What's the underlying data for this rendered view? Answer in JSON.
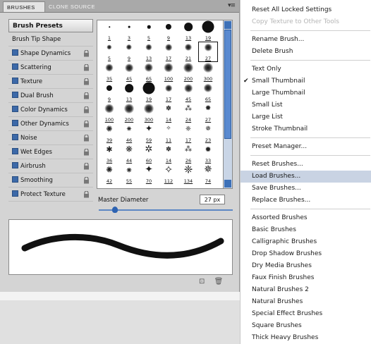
{
  "panel": {
    "tabs": [
      "BRUSHES",
      "CLONE SOURCE"
    ],
    "menu_icon": "panel-menu-icon"
  },
  "sidebar": {
    "header": "Brush Presets",
    "items": [
      {
        "label": "Brush Tip Shape",
        "checkbox": false,
        "lock": false
      },
      {
        "label": "Shape Dynamics",
        "checkbox": true,
        "lock": true
      },
      {
        "label": "Scattering",
        "checkbox": true,
        "lock": true
      },
      {
        "label": "Texture",
        "checkbox": true,
        "lock": true
      },
      {
        "label": "Dual Brush",
        "checkbox": true,
        "lock": true
      },
      {
        "label": "Color Dynamics",
        "checkbox": true,
        "lock": true
      },
      {
        "label": "Other Dynamics",
        "checkbox": true,
        "lock": true
      },
      {
        "label": "Noise",
        "checkbox": true,
        "lock": true
      },
      {
        "label": "Wet Edges",
        "checkbox": true,
        "lock": true
      },
      {
        "label": "Airbrush",
        "checkbox": true,
        "lock": true
      },
      {
        "label": "Smoothing",
        "checkbox": true,
        "lock": true
      },
      {
        "label": "Protect Texture",
        "checkbox": true,
        "lock": true
      }
    ]
  },
  "brushes": [
    {
      "size": "1",
      "kind": "hard"
    },
    {
      "size": "3",
      "kind": "hard"
    },
    {
      "size": "5",
      "kind": "hard"
    },
    {
      "size": "9",
      "kind": "hard"
    },
    {
      "size": "13",
      "kind": "hard"
    },
    {
      "size": "19",
      "kind": "hard"
    },
    {
      "size": "5",
      "kind": "soft"
    },
    {
      "size": "9",
      "kind": "soft"
    },
    {
      "size": "13",
      "kind": "soft"
    },
    {
      "size": "17",
      "kind": "soft"
    },
    {
      "size": "21",
      "kind": "soft"
    },
    {
      "size": "27",
      "kind": "soft"
    },
    {
      "size": "35",
      "kind": "soft"
    },
    {
      "size": "45",
      "kind": "soft"
    },
    {
      "size": "65",
      "kind": "soft"
    },
    {
      "size": "100",
      "kind": "soft"
    },
    {
      "size": "200",
      "kind": "soft"
    },
    {
      "size": "300",
      "kind": "soft"
    },
    {
      "size": "9",
      "kind": "hard"
    },
    {
      "size": "13",
      "kind": "hard"
    },
    {
      "size": "19",
      "kind": "hard"
    },
    {
      "size": "17",
      "kind": "soft"
    },
    {
      "size": "45",
      "kind": "soft"
    },
    {
      "size": "65",
      "kind": "soft"
    },
    {
      "size": "100",
      "kind": "soft"
    },
    {
      "size": "200",
      "kind": "soft"
    },
    {
      "size": "300",
      "kind": "soft"
    },
    {
      "size": "14",
      "kind": "special"
    },
    {
      "size": "24",
      "kind": "special"
    },
    {
      "size": "27",
      "kind": "special"
    },
    {
      "size": "39",
      "kind": "special"
    },
    {
      "size": "46",
      "kind": "special"
    },
    {
      "size": "59",
      "kind": "special"
    },
    {
      "size": "11",
      "kind": "special"
    },
    {
      "size": "17",
      "kind": "special"
    },
    {
      "size": "23",
      "kind": "special"
    },
    {
      "size": "36",
      "kind": "special"
    },
    {
      "size": "44",
      "kind": "special"
    },
    {
      "size": "60",
      "kind": "special"
    },
    {
      "size": "14",
      "kind": "special"
    },
    {
      "size": "26",
      "kind": "special"
    },
    {
      "size": "33",
      "kind": "special"
    },
    {
      "size": "42",
      "kind": "special"
    },
    {
      "size": "55",
      "kind": "special"
    },
    {
      "size": "70",
      "kind": "special"
    },
    {
      "size": "112",
      "kind": "special"
    },
    {
      "size": "134",
      "kind": "special"
    },
    {
      "size": "74",
      "kind": "special"
    }
  ],
  "selected_brush_index": 11,
  "master": {
    "label": "Master Diameter",
    "value": "27 px",
    "slider_fraction": 0.1
  },
  "menu": {
    "groups": [
      [
        {
          "label": "Reset All Locked Settings",
          "disabled": false
        },
        {
          "label": "Copy Texture to Other Tools",
          "disabled": true
        }
      ],
      [
        {
          "label": "Rename Brush...",
          "disabled": false
        },
        {
          "label": "Delete Brush",
          "disabled": false
        }
      ],
      [
        {
          "label": "Text Only",
          "disabled": false
        },
        {
          "label": "Small Thumbnail",
          "disabled": false,
          "checked": true
        },
        {
          "label": "Large Thumbnail",
          "disabled": false
        },
        {
          "label": "Small List",
          "disabled": false
        },
        {
          "label": "Large List",
          "disabled": false
        },
        {
          "label": "Stroke Thumbnail",
          "disabled": false
        }
      ],
      [
        {
          "label": "Preset Manager...",
          "disabled": false
        }
      ],
      [
        {
          "label": "Reset Brushes...",
          "disabled": false
        },
        {
          "label": "Load Brushes...",
          "disabled": false,
          "highlighted": true
        },
        {
          "label": "Save Brushes...",
          "disabled": false
        },
        {
          "label": "Replace Brushes...",
          "disabled": false
        }
      ],
      [
        {
          "label": "Assorted Brushes",
          "disabled": false
        },
        {
          "label": "Basic Brushes",
          "disabled": false
        },
        {
          "label": "Calligraphic Brushes",
          "disabled": false
        },
        {
          "label": "Drop Shadow Brushes",
          "disabled": false
        },
        {
          "label": "Dry Media Brushes",
          "disabled": false
        },
        {
          "label": "Faux Finish Brushes",
          "disabled": false
        },
        {
          "label": "Natural Brushes 2",
          "disabled": false
        },
        {
          "label": "Natural Brushes",
          "disabled": false
        },
        {
          "label": "Special Effect Brushes",
          "disabled": false
        },
        {
          "label": "Square Brushes",
          "disabled": false
        },
        {
          "label": "Thick Heavy Brushes",
          "disabled": false
        }
      ]
    ]
  }
}
